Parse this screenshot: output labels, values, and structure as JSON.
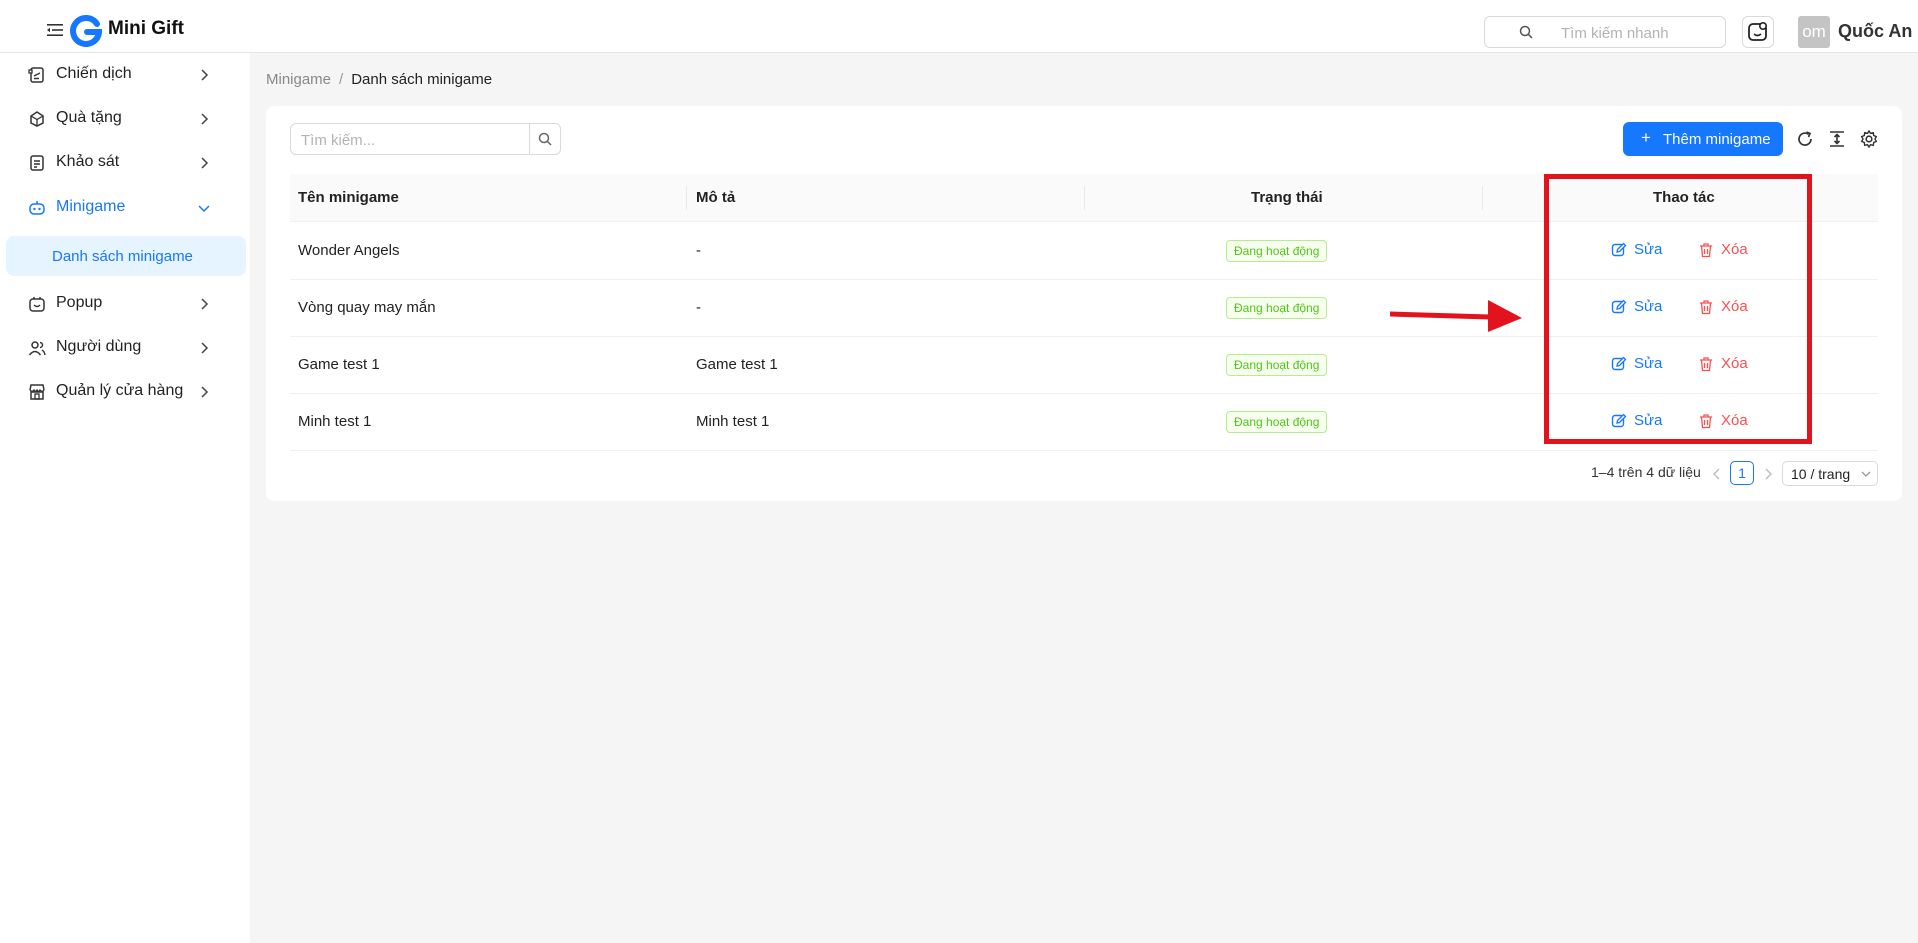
{
  "header": {
    "app_title": "Mini Gift",
    "search_placeholder": "Tìm kiếm nhanh",
    "avatar_text": "om",
    "username": "Quốc An"
  },
  "sidebar": {
    "items": [
      {
        "label": "Chiến dịch",
        "icon": "campaign-icon"
      },
      {
        "label": "Quà tặng",
        "icon": "gift-icon"
      },
      {
        "label": "Khảo sát",
        "icon": "survey-icon"
      },
      {
        "label": "Minigame",
        "icon": "gamepad-icon",
        "active": true
      },
      {
        "label": "Popup",
        "icon": "popup-icon"
      },
      {
        "label": "Người dùng",
        "icon": "users-icon"
      },
      {
        "label": "Quản lý cửa hàng",
        "icon": "store-icon"
      }
    ],
    "sub_item": "Danh sách minigame"
  },
  "breadcrumb": {
    "parent": "Minigame",
    "separator": "/",
    "current": "Danh sách minigame"
  },
  "toolbar": {
    "search_placeholder": "Tìm kiếm...",
    "add_label": "Thêm minigame"
  },
  "table": {
    "columns": [
      "Tên minigame",
      "Mô tả",
      "Trạng thái",
      "Thao tác"
    ],
    "rows": [
      {
        "name": "Wonder Angels",
        "description": "-",
        "status": "Đang hoạt động"
      },
      {
        "name": "Vòng quay may mắn",
        "description": "-",
        "status": "Đang hoạt động"
      },
      {
        "name": "Game test 1",
        "description": "Game test 1",
        "status": "Đang hoạt động"
      },
      {
        "name": "Minh test 1",
        "description": "Minh test 1",
        "status": "Đang hoạt động"
      }
    ],
    "edit_label": "Sửa",
    "delete_label": "Xóa"
  },
  "pagination": {
    "total_text": "1–4 trên 4 dữ liệu",
    "current_page": "1",
    "page_size": "10 / trang"
  },
  "colors": {
    "primary": "#1677ff",
    "danger": "#ff4d4f",
    "success": "#52c41a",
    "annotation": "#e3131e"
  }
}
